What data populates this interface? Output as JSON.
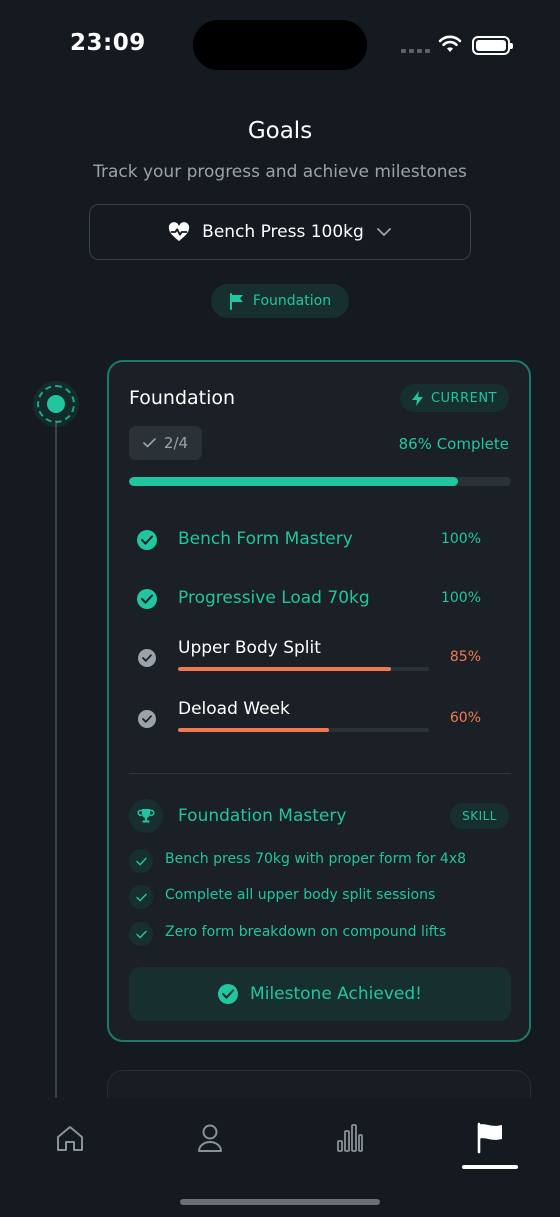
{
  "status": {
    "time": "23:09"
  },
  "header": {
    "title": "Goals",
    "subtitle": "Track your progress and achieve milestones"
  },
  "goal_selector": {
    "value": "Bench Press 100kg",
    "icon": "heart-pulse-icon"
  },
  "phase_pill": {
    "label": "Foundation",
    "icon": "flag-icon"
  },
  "phase_card": {
    "title": "Foundation",
    "badge": "CURRENT",
    "count": "2/4",
    "complete_text": "86% Complete",
    "progress": 0.86,
    "milestones": [
      {
        "label": "Bench Form Mastery",
        "percent": "100%",
        "status": "done",
        "progress": 1.0
      },
      {
        "label": "Progressive Load 70kg",
        "percent": "100%",
        "status": "done",
        "progress": 1.0
      },
      {
        "label": "Upper Body Split",
        "percent": "85%",
        "status": "pending",
        "progress": 0.85
      },
      {
        "label": "Deload Week",
        "percent": "60%",
        "status": "pending",
        "progress": 0.6
      }
    ],
    "skill": {
      "title": "Foundation Mastery",
      "badge": "SKILL",
      "icon": "trophy-icon",
      "requirements": [
        "Bench press 70kg with proper form for 4x8",
        "Complete all upper body split sessions",
        "Zero form breakdown on compound lifts"
      ]
    },
    "achieved_label": "Milestone Achieved!"
  },
  "tabs": [
    {
      "name": "home",
      "icon": "home-icon",
      "active": false
    },
    {
      "name": "profile",
      "icon": "user-icon",
      "active": false
    },
    {
      "name": "stats",
      "icon": "bar-chart-icon",
      "active": false
    },
    {
      "name": "goals",
      "icon": "flag-icon",
      "active": true
    }
  ],
  "colors": {
    "accent": "#21c59f",
    "warning": "#ef7a52",
    "background": "#141a1f",
    "card": "#1a2025"
  }
}
